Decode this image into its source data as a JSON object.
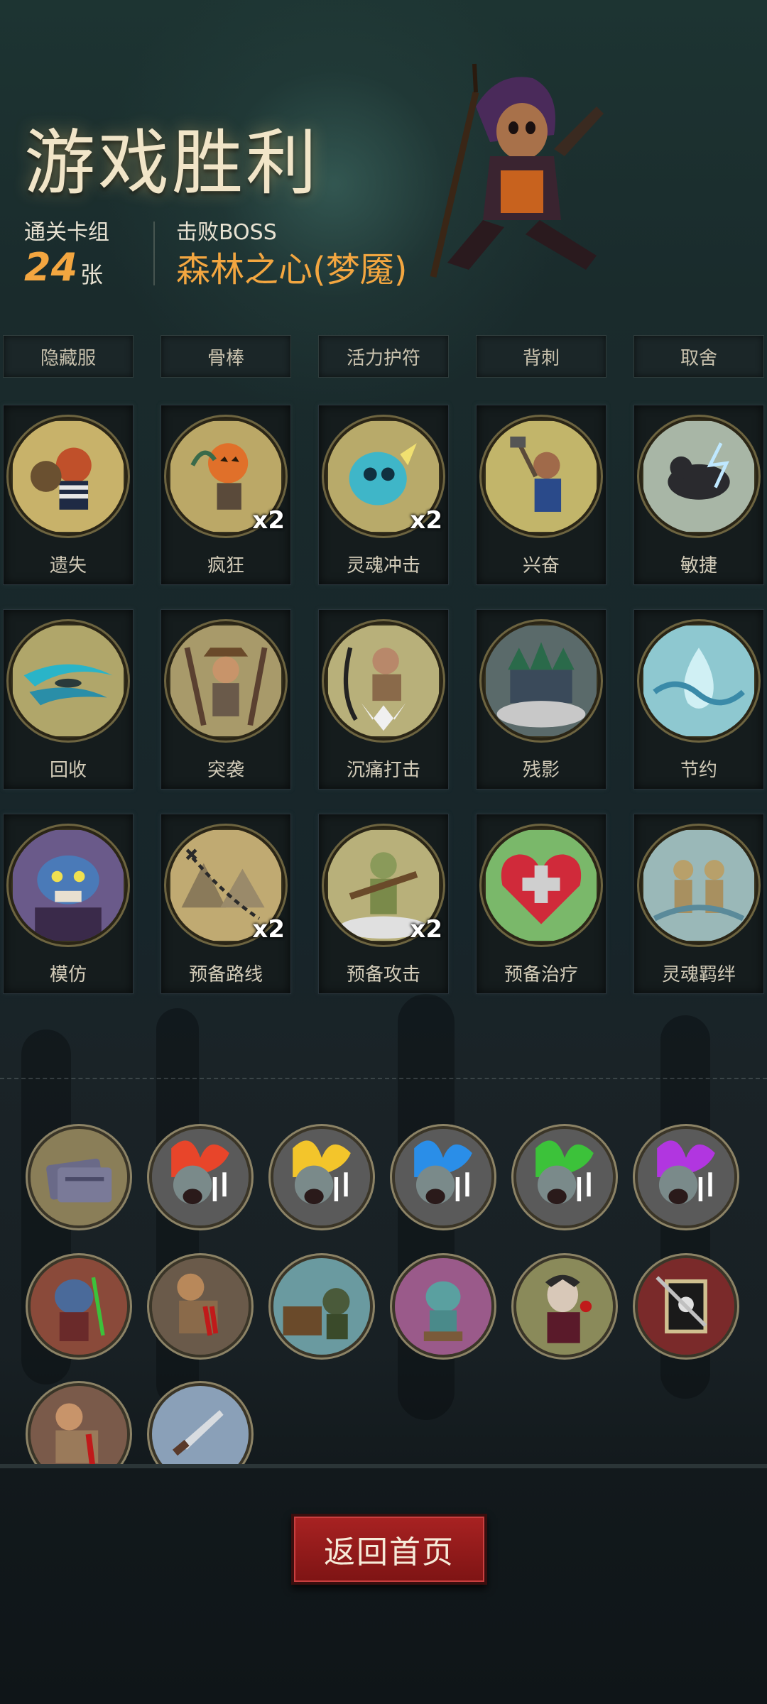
{
  "header": {
    "title": "游戏胜利",
    "deck_label": "通关卡组",
    "deck_count": "24",
    "deck_unit": "张",
    "boss_label": "击败BOSS",
    "boss_name": "森林之心(梦魇)"
  },
  "equipment_tabs": [
    "隐藏服",
    "骨棒",
    "活力护符",
    "背刺",
    "取舍"
  ],
  "cards": [
    {
      "name": "遗失",
      "icon": "thief-icon",
      "mult": ""
    },
    {
      "name": "疯狂",
      "icon": "pumpkin-head-icon",
      "mult": "x2"
    },
    {
      "name": "灵魂冲击",
      "icon": "soul-skull-icon",
      "mult": "x2"
    },
    {
      "name": "兴奋",
      "icon": "hammer-dwarf-icon",
      "mult": ""
    },
    {
      "name": "敏捷",
      "icon": "panther-icon",
      "mult": ""
    },
    {
      "name": "回收",
      "icon": "water-swirl-icon",
      "mult": ""
    },
    {
      "name": "突袭",
      "icon": "ambush-icon",
      "mult": ""
    },
    {
      "name": "沉痛打击",
      "icon": "heavy-strike-icon",
      "mult": ""
    },
    {
      "name": "残影",
      "icon": "afterimage-icon",
      "mult": ""
    },
    {
      "name": "节约",
      "icon": "water-drop-icon",
      "mult": ""
    },
    {
      "name": "模仿",
      "icon": "mimic-goblin-icon",
      "mult": ""
    },
    {
      "name": "预备路线",
      "icon": "map-route-icon",
      "mult": "x2"
    },
    {
      "name": "预备攻击",
      "icon": "ready-attack-icon",
      "mult": "x2"
    },
    {
      "name": "预备治疗",
      "icon": "heart-cross-icon",
      "mult": ""
    },
    {
      "name": "灵魂羁绊",
      "icon": "soul-bond-icon",
      "mult": ""
    }
  ],
  "relics": [
    {
      "icon": "tickets-icon"
    },
    {
      "icon": "bard-red-flame-icon"
    },
    {
      "icon": "bard-yellow-flame-icon"
    },
    {
      "icon": "bard-blue-flame-icon"
    },
    {
      "icon": "bard-green-flame-icon"
    },
    {
      "icon": "bard-purple-flame-icon"
    },
    {
      "icon": "goblin-warrior-icon"
    },
    {
      "icon": "bleeding-hands-icon"
    },
    {
      "icon": "treasure-ghoul-icon"
    },
    {
      "icon": "gargoyle-icon"
    },
    {
      "icon": "vampire-icon"
    },
    {
      "icon": "skull-sword-banner-icon"
    },
    {
      "icon": "bleeding-fist-icon"
    },
    {
      "icon": "dagger-icon"
    }
  ],
  "colors": {
    "accent_gold": "#f3a640",
    "title": "#f1e5c8",
    "button_red": "#a82222",
    "flame_red": "#e8452a",
    "flame_yellow": "#f3c52b",
    "flame_blue": "#2a8ee8",
    "flame_green": "#3cc23a",
    "flame_purple": "#b136e0"
  },
  "footer": {
    "home_button_label": "返回首页"
  }
}
